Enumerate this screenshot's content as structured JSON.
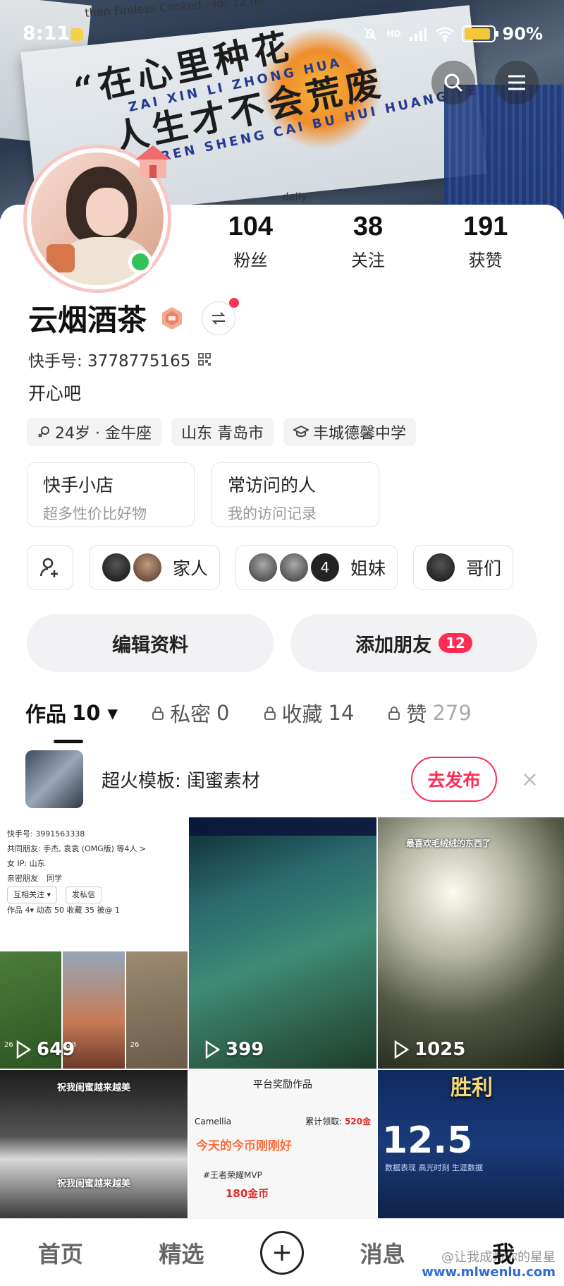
{
  "status_bar": {
    "time": "8:11",
    "battery_percent_label": "90%",
    "battery_level": 0.9,
    "signal_label": "HD"
  },
  "banner": {
    "scrap_top": "then Fireless Cooked  --for 12 ho",
    "quote_line1": "“在心里种花",
    "pinyin_line1": "ZAI XIN LI ZHONG HUA",
    "quote_line2": "人生才不会荒废",
    "pinyin_line2": "REN SHENG CAI BU HUI HUANG FEI",
    "scrap_bottom": "daily"
  },
  "stats": [
    {
      "num": "104",
      "label": "粉丝"
    },
    {
      "num": "38",
      "label": "关注"
    },
    {
      "num": "191",
      "label": "获赞"
    }
  ],
  "profile": {
    "name": "云烟酒茶",
    "kuaishou_id": "快手号: 3778775165",
    "bio": "开心吧",
    "tags": [
      "24岁 · 金牛座",
      "山东 青岛市",
      "丰城德馨中学"
    ]
  },
  "shortcuts": [
    {
      "title": "快手小店",
      "sub": "超多性价比好物"
    },
    {
      "title": "常访问的人",
      "sub": "我的访问记录"
    }
  ],
  "groups": [
    {
      "label": "家人"
    },
    {
      "label": "姐妹",
      "extra": "4"
    },
    {
      "label": "哥们"
    }
  ],
  "actions": {
    "edit": "编辑资料",
    "add_friend": "添加朋友",
    "add_friend_count": "12"
  },
  "tabs": [
    {
      "label": "作品",
      "count": "10 ▾"
    },
    {
      "label": "私密",
      "count": "0"
    },
    {
      "label": "收藏",
      "count": "14"
    },
    {
      "label": "赞",
      "count": "279"
    }
  ],
  "template": {
    "text": "超火模板: 闺蜜素材",
    "button": "去发布",
    "close": "×"
  },
  "grid": {
    "cell1": {
      "plays": "649",
      "id_line": "快手号: 3991563338",
      "friends_line": "共同朋友: 手杰, 袁袁 (OMG版) 等4人 >",
      "ip_line": "女   IP: 山东",
      "chip1": "亲密朋友",
      "chip2": "同学",
      "btn1": "互相关注 ▾",
      "btn2": "发私信",
      "tabs_line": "作品 4▾    动态 50    收藏 35    被@ 1",
      "photo_counts": [
        "26",
        "23",
        "26"
      ]
    },
    "cell2": {
      "plays": "399"
    },
    "cell3": {
      "plays": "1025",
      "caption": "最喜欢毛绒绒的东西了"
    },
    "cell4": {
      "caption_top": "祝我闺蜜越来越美",
      "caption_bottom": "祝我闺蜜越来越美"
    },
    "cell5": {
      "head": "平台奖励作品",
      "user": "Camellia",
      "total_label": "累计领取:",
      "total_amount": "520金",
      "banner": "今天的今币刚刚好",
      "tag": "#王者荣耀MVP",
      "gold": "180金币"
    },
    "cell6": {
      "win": "胜利",
      "score": "12.5",
      "row": "数据表现   高光时刻   生涯数据"
    }
  },
  "bottom_nav": [
    "首页",
    "精选",
    "消息",
    "我"
  ],
  "watermark": {
    "line1": "@让我成为你的星星",
    "url": "www.mlwenlu.com"
  },
  "colors": {
    "accent": "#fe2c55",
    "online": "#33c25a",
    "battery": "#f5c53a"
  }
}
